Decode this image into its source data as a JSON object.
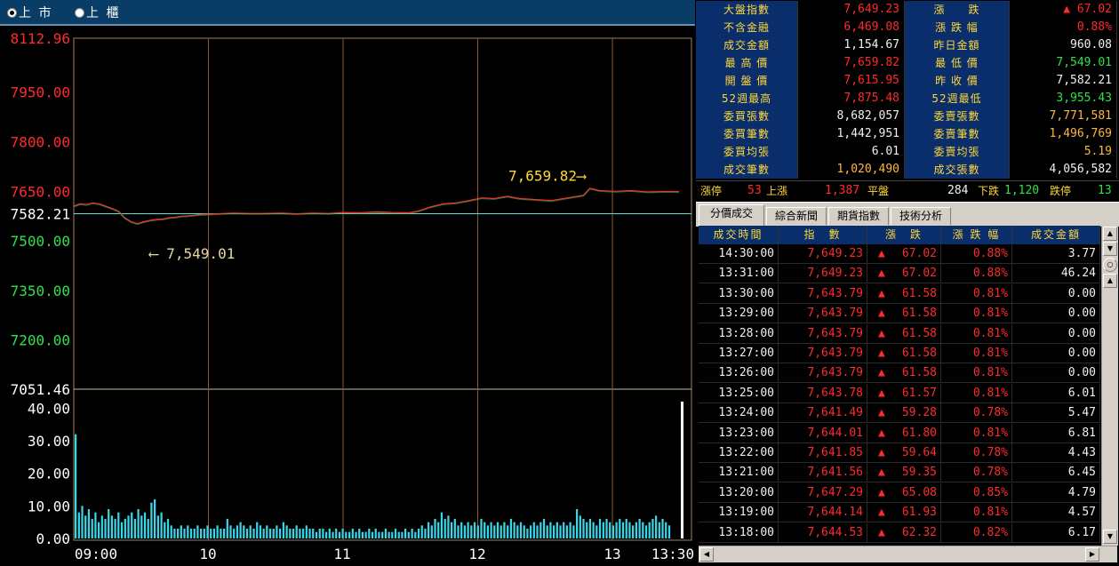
{
  "market_selector": {
    "options": [
      {
        "label": "上 市",
        "selected": true
      },
      {
        "label": "上 櫃",
        "selected": false
      }
    ]
  },
  "chart_data": {
    "type": "line",
    "price_axis": {
      "ticks": [
        "8112.96",
        "7950.00",
        "7800.00",
        "7650.00",
        "7582.21",
        "7500.00",
        "7350.00",
        "7200.00",
        "7051.46"
      ],
      "ylim": [
        7051.46,
        8112.96
      ],
      "reference": 7582.21
    },
    "volume_axis": {
      "ticks": [
        "40.00",
        "30.00",
        "20.00",
        "10.00",
        "0.00"
      ],
      "ylim": [
        0,
        42
      ]
    },
    "x_labels": [
      "09:00",
      "10",
      "11",
      "12",
      "13",
      "13:30"
    ],
    "annotations": [
      {
        "text": "7,659.82",
        "value": 7659.82,
        "kind": "high"
      },
      {
        "text": "7,549.01",
        "value": 7549.01,
        "kind": "low"
      }
    ],
    "price_series": [
      [
        0,
        7605
      ],
      [
        2,
        7612
      ],
      [
        4,
        7610
      ],
      [
        6,
        7615
      ],
      [
        8,
        7612
      ],
      [
        10,
        7605
      ],
      [
        12,
        7598
      ],
      [
        14,
        7590
      ],
      [
        16,
        7570
      ],
      [
        18,
        7558
      ],
      [
        20,
        7552
      ],
      [
        22,
        7558
      ],
      [
        24,
        7562
      ],
      [
        26,
        7565
      ],
      [
        28,
        7566
      ],
      [
        30,
        7570
      ],
      [
        32,
        7572
      ],
      [
        34,
        7575
      ],
      [
        36,
        7576
      ],
      [
        38,
        7578
      ],
      [
        40,
        7580
      ],
      [
        45,
        7582
      ],
      [
        50,
        7584
      ],
      [
        55,
        7583
      ],
      [
        60,
        7583
      ],
      [
        65,
        7584
      ],
      [
        70,
        7582
      ],
      [
        75,
        7584
      ],
      [
        80,
        7583
      ],
      [
        85,
        7586
      ],
      [
        90,
        7585
      ],
      [
        95,
        7588
      ],
      [
        100,
        7586
      ],
      [
        105,
        7585
      ],
      [
        108,
        7590
      ],
      [
        112,
        7603
      ],
      [
        116,
        7612
      ],
      [
        120,
        7615
      ],
      [
        124,
        7622
      ],
      [
        128,
        7630
      ],
      [
        132,
        7628
      ],
      [
        136,
        7635
      ],
      [
        140,
        7628
      ],
      [
        145,
        7625
      ],
      [
        150,
        7622
      ],
      [
        155,
        7630
      ],
      [
        160,
        7638
      ],
      [
        162,
        7659
      ],
      [
        165,
        7652
      ],
      [
        170,
        7650
      ],
      [
        175,
        7652
      ],
      [
        180,
        7648
      ],
      [
        185,
        7649
      ],
      [
        190,
        7649
      ]
    ],
    "volume_series": [
      32,
      8,
      10,
      7,
      9,
      6,
      8,
      5,
      7,
      6,
      9,
      7,
      6,
      8,
      5,
      6,
      7,
      8,
      6,
      9,
      7,
      8,
      6,
      11,
      12,
      7,
      8,
      5,
      6,
      4,
      3,
      3,
      4,
      3,
      4,
      3,
      3,
      4,
      3,
      3,
      4,
      3,
      3,
      4,
      3,
      3,
      6,
      4,
      3,
      4,
      5,
      4,
      3,
      4,
      3,
      5,
      4,
      3,
      4,
      3,
      3,
      4,
      3,
      5,
      4,
      3,
      3,
      4,
      3,
      3,
      4,
      3,
      3,
      2,
      3,
      3,
      2,
      3,
      2,
      3,
      2,
      3,
      2,
      2,
      3,
      2,
      3,
      2,
      2,
      3,
      2,
      3,
      2,
      2,
      3,
      2,
      2,
      3,
      2,
      2,
      3,
      2,
      3,
      2,
      3,
      4,
      3,
      5,
      4,
      6,
      5,
      8,
      6,
      7,
      5,
      6,
      4,
      5,
      4,
      5,
      4,
      5,
      4,
      6,
      5,
      4,
      5,
      4,
      5,
      4,
      5,
      4,
      6,
      5,
      4,
      5,
      4,
      3,
      4,
      5,
      4,
      5,
      6,
      4,
      5,
      4,
      5,
      4,
      5,
      4,
      5,
      4,
      9,
      7,
      6,
      5,
      6,
      5,
      4,
      6,
      5,
      6,
      5,
      4,
      5,
      6,
      5,
      6,
      5,
      4,
      5,
      6,
      5,
      4,
      5,
      6,
      7,
      5,
      6,
      5,
      4
    ],
    "closing_spike": 42
  },
  "info_panel": {
    "rows": [
      {
        "l1": "大盤指數",
        "v1": "7,649.23",
        "c1": "red",
        "l2": "漲　　跌",
        "v2": "▲ 67.02",
        "c2": "red"
      },
      {
        "l1": "不含金融",
        "v1": "6,469.08",
        "c1": "red",
        "l2": "漲 跌 幅",
        "v2": "0.88%",
        "c2": "red"
      },
      {
        "l1": "成交金額",
        "v1": "1,154.67",
        "c1": "white",
        "l2": "昨日金額",
        "v2": "960.08",
        "c2": "white"
      },
      {
        "l1": "最 高 價",
        "v1": "7,659.82",
        "c1": "red",
        "l2": "最 低 價",
        "v2": "7,549.01",
        "c2": "green"
      },
      {
        "l1": "開 盤 價",
        "v1": "7,615.95",
        "c1": "red",
        "l2": "昨 收 價",
        "v2": "7,582.21",
        "c2": "white"
      },
      {
        "l1": "52週最高",
        "v1": "7,875.48",
        "c1": "red",
        "l2": "52週最低",
        "v2": "3,955.43",
        "c2": "green"
      },
      {
        "l1": "委買張數",
        "v1": "8,682,057",
        "c1": "white",
        "l2": "委賣張數",
        "v2": "7,771,581",
        "c2": "orange"
      },
      {
        "l1": "委買筆數",
        "v1": "1,442,951",
        "c1": "white",
        "l2": "委賣筆數",
        "v2": "1,496,769",
        "c2": "orange"
      },
      {
        "l1": "委買均張",
        "v1": "6.01",
        "c1": "white",
        "l2": "委賣均張",
        "v2": "5.19",
        "c2": "orange"
      },
      {
        "l1": "成交筆數",
        "v1": "1,020,490",
        "c1": "orange",
        "l2": "成交張數",
        "v2": "4,056,582",
        "c2": "white"
      }
    ]
  },
  "stats_bar": {
    "limit_up_label": "漲停",
    "limit_up": "53",
    "up_label": "上漲",
    "up": "1,387",
    "flat_label": "平盤",
    "flat": "284",
    "down_label": "下跌",
    "down": "1,120",
    "limit_down_label": "跌停",
    "limit_down": "13"
  },
  "tabs": [
    {
      "label": "分價成交",
      "active": true
    },
    {
      "label": "綜合新聞",
      "active": false
    },
    {
      "label": "期貨指數",
      "active": false
    },
    {
      "label": "技術分析",
      "active": false
    }
  ],
  "trades_table": {
    "headers": [
      "成交時間",
      "指　數",
      "漲　跌",
      "漲 跌 幅",
      "成交金額"
    ],
    "rows": [
      [
        "14:30:00",
        "7,649.23",
        "67.02",
        "0.88%",
        "3.77"
      ],
      [
        "13:31:00",
        "7,649.23",
        "67.02",
        "0.88%",
        "46.24"
      ],
      [
        "13:30:00",
        "7,643.79",
        "61.58",
        "0.81%",
        "0.00"
      ],
      [
        "13:29:00",
        "7,643.79",
        "61.58",
        "0.81%",
        "0.00"
      ],
      [
        "13:28:00",
        "7,643.79",
        "61.58",
        "0.81%",
        "0.00"
      ],
      [
        "13:27:00",
        "7,643.79",
        "61.58",
        "0.81%",
        "0.00"
      ],
      [
        "13:26:00",
        "7,643.79",
        "61.58",
        "0.81%",
        "0.00"
      ],
      [
        "13:25:00",
        "7,643.78",
        "61.57",
        "0.81%",
        "6.01"
      ],
      [
        "13:24:00",
        "7,641.49",
        "59.28",
        "0.78%",
        "5.47"
      ],
      [
        "13:23:00",
        "7,644.01",
        "61.80",
        "0.81%",
        "6.81"
      ],
      [
        "13:22:00",
        "7,641.85",
        "59.64",
        "0.78%",
        "4.43"
      ],
      [
        "13:21:00",
        "7,641.56",
        "59.35",
        "0.78%",
        "6.45"
      ],
      [
        "13:20:00",
        "7,647.29",
        "65.08",
        "0.85%",
        "4.79"
      ],
      [
        "13:19:00",
        "7,644.14",
        "61.93",
        "0.81%",
        "4.57"
      ],
      [
        "13:18:00",
        "7,644.53",
        "62.32",
        "0.82%",
        "6.17"
      ]
    ],
    "up_arrow": "▲"
  },
  "colors": {
    "up": "#ff2b2b",
    "down": "#31e04a",
    "label": "#ffd93a",
    "header_bg": "#0a2d6b",
    "price_line": "#ff3030",
    "volume_bar": "#39d6e8",
    "reference_line": "#4fe6d4",
    "grid": "#8a5a3a"
  }
}
